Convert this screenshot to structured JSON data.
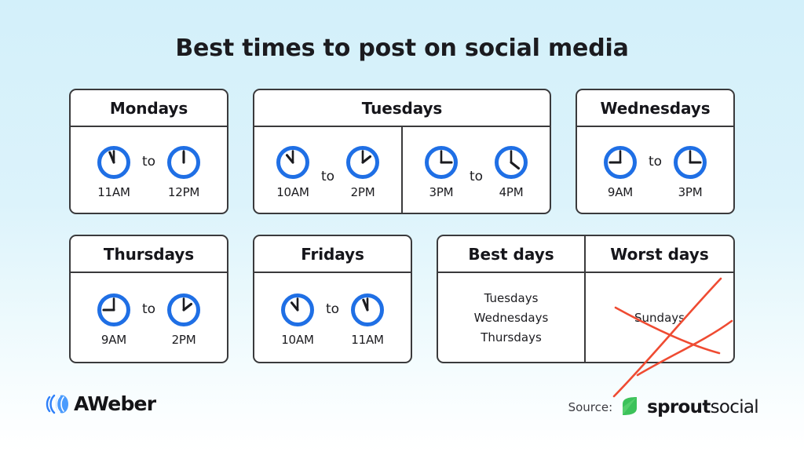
{
  "title": "Best times to post on social media",
  "colors": {
    "clock_ring": "#1f6fe5",
    "clock_hand": "#1b1b1f",
    "card_border": "#3a3a3c",
    "cross_red": "#ef4b32",
    "background_top": "#d3f0fa",
    "background_bottom": "#ffffff",
    "sprout_leaf": "#3cc25a"
  },
  "cards": [
    {
      "day": "Mondays",
      "ranges": [
        {
          "start": {
            "label": "11AM",
            "hour": 11,
            "minute": 0
          },
          "separator": "to",
          "end": {
            "label": "12PM",
            "hour": 12,
            "minute": 0
          }
        }
      ]
    },
    {
      "day": "Tuesdays",
      "ranges": [
        {
          "start": {
            "label": "10AM",
            "hour": 10,
            "minute": 0
          },
          "separator": "to",
          "end": {
            "label": "2PM",
            "hour": 2,
            "minute": 0
          }
        },
        {
          "start": {
            "label": "3PM",
            "hour": 3,
            "minute": 0
          },
          "separator": "to",
          "end": {
            "label": "4PM",
            "hour": 4,
            "minute": 0
          }
        }
      ]
    },
    {
      "day": "Wednesdays",
      "ranges": [
        {
          "start": {
            "label": "9AM",
            "hour": 9,
            "minute": 0
          },
          "separator": "to",
          "end": {
            "label": "3PM",
            "hour": 3,
            "minute": 0
          }
        }
      ]
    },
    {
      "day": "Thursdays",
      "ranges": [
        {
          "start": {
            "label": "9AM",
            "hour": 9,
            "minute": 0
          },
          "separator": "to",
          "end": {
            "label": "2PM",
            "hour": 2,
            "minute": 0
          }
        }
      ]
    },
    {
      "day": "Fridays",
      "ranges": [
        {
          "start": {
            "label": "10AM",
            "hour": 10,
            "minute": 0
          },
          "separator": "to",
          "end": {
            "label": "11AM",
            "hour": 11,
            "minute": 0
          }
        }
      ]
    }
  ],
  "days_table": {
    "best_header": "Best days",
    "worst_header": "Worst days",
    "best_days": [
      "Tuesdays",
      "Wednesdays",
      "Thursdays"
    ],
    "worst_days": [
      "Sundays"
    ],
    "worst_crossed_out": true
  },
  "footer": {
    "brand": "AWeber",
    "source_label": "Source:",
    "source_name_bold": "sprout",
    "source_name_light": "social"
  }
}
